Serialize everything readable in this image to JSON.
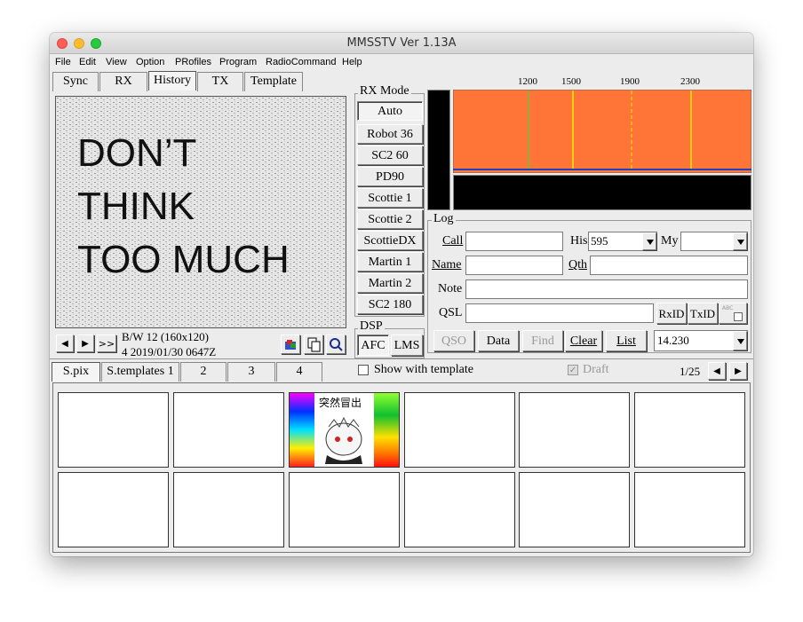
{
  "window": {
    "title": "MMSSTV Ver 1.13A"
  },
  "menu": [
    "File",
    "Edit",
    "View",
    "Option",
    "PRofiles",
    "Program",
    "RadioCommand",
    "Help"
  ],
  "tabs": [
    "Sync",
    "RX",
    "History",
    "TX",
    "Template"
  ],
  "image": {
    "text_lines": [
      "DON’T",
      "THINK",
      "TOO MUCH"
    ]
  },
  "nav": {
    "prev": "◀",
    "next": "▶",
    "fast": ">>"
  },
  "status": {
    "line1": "B/W 12 (160x120)",
    "line2": "4 2019/01/30 0647Z"
  },
  "rx_mode": {
    "title": "RX Mode",
    "modes": [
      "Auto",
      "Robot 36",
      "SC2 60",
      "PD90",
      "Scottie 1",
      "Scottie 2",
      "ScottieDX",
      "Martin 1",
      "Martin 2",
      "SC2 180"
    ]
  },
  "dsp": {
    "title": "DSP",
    "afc": "AFC",
    "lms": "LMS"
  },
  "spectrum": {
    "ticks": [
      "1200",
      "1500",
      "1900",
      "2300"
    ],
    "colors": {
      "bg": "#ff7538",
      "line_green": "#6cc040",
      "line_yellow": "#ffee00"
    }
  },
  "log": {
    "title": "Log",
    "call_label": "Call",
    "call_value": "",
    "his_label": "His",
    "his_value": "595",
    "my_label": "My",
    "my_value": "",
    "name_label": "Name",
    "name_value": "",
    "qth_label": "Qth",
    "qth_value": "",
    "note_label": "Note",
    "note_value": "",
    "qsl_label": "QSL",
    "qsl_value": "",
    "rxid": "RxID",
    "txid": "TxID",
    "abc": "ABC"
  },
  "log_buttons": {
    "qso": "QSO",
    "data": "Data",
    "find": "Find",
    "clear": "Clear",
    "list": "List",
    "freq": "14.230"
  },
  "bottom_tabs": [
    "S.pix",
    "S.templates 1",
    "2",
    "3",
    "4"
  ],
  "template_opts": {
    "show_with_template": "Show with template",
    "draft": "Draft",
    "page": "1/25"
  },
  "thumbnail": {
    "caption": "突然冒出"
  }
}
